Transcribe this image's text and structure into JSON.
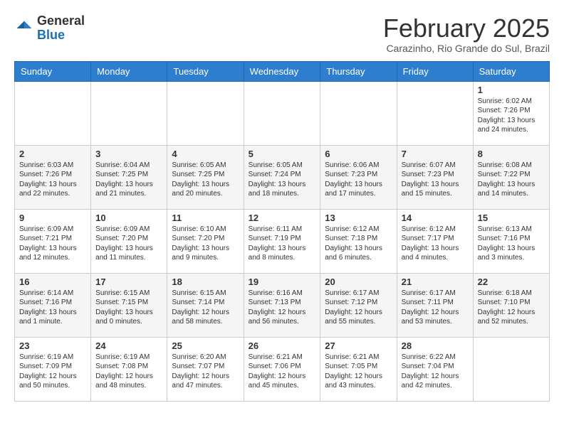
{
  "header": {
    "logo_general": "General",
    "logo_blue": "Blue",
    "month": "February 2025",
    "location": "Carazinho, Rio Grande do Sul, Brazil"
  },
  "weekdays": [
    "Sunday",
    "Monday",
    "Tuesday",
    "Wednesday",
    "Thursday",
    "Friday",
    "Saturday"
  ],
  "weeks": [
    [
      {
        "day": "",
        "info": ""
      },
      {
        "day": "",
        "info": ""
      },
      {
        "day": "",
        "info": ""
      },
      {
        "day": "",
        "info": ""
      },
      {
        "day": "",
        "info": ""
      },
      {
        "day": "",
        "info": ""
      },
      {
        "day": "1",
        "info": "Sunrise: 6:02 AM\nSunset: 7:26 PM\nDaylight: 13 hours\nand 24 minutes."
      }
    ],
    [
      {
        "day": "2",
        "info": "Sunrise: 6:03 AM\nSunset: 7:26 PM\nDaylight: 13 hours\nand 22 minutes."
      },
      {
        "day": "3",
        "info": "Sunrise: 6:04 AM\nSunset: 7:25 PM\nDaylight: 13 hours\nand 21 minutes."
      },
      {
        "day": "4",
        "info": "Sunrise: 6:05 AM\nSunset: 7:25 PM\nDaylight: 13 hours\nand 20 minutes."
      },
      {
        "day": "5",
        "info": "Sunrise: 6:05 AM\nSunset: 7:24 PM\nDaylight: 13 hours\nand 18 minutes."
      },
      {
        "day": "6",
        "info": "Sunrise: 6:06 AM\nSunset: 7:23 PM\nDaylight: 13 hours\nand 17 minutes."
      },
      {
        "day": "7",
        "info": "Sunrise: 6:07 AM\nSunset: 7:23 PM\nDaylight: 13 hours\nand 15 minutes."
      },
      {
        "day": "8",
        "info": "Sunrise: 6:08 AM\nSunset: 7:22 PM\nDaylight: 13 hours\nand 14 minutes."
      }
    ],
    [
      {
        "day": "9",
        "info": "Sunrise: 6:09 AM\nSunset: 7:21 PM\nDaylight: 13 hours\nand 12 minutes."
      },
      {
        "day": "10",
        "info": "Sunrise: 6:09 AM\nSunset: 7:20 PM\nDaylight: 13 hours\nand 11 minutes."
      },
      {
        "day": "11",
        "info": "Sunrise: 6:10 AM\nSunset: 7:20 PM\nDaylight: 13 hours\nand 9 minutes."
      },
      {
        "day": "12",
        "info": "Sunrise: 6:11 AM\nSunset: 7:19 PM\nDaylight: 13 hours\nand 8 minutes."
      },
      {
        "day": "13",
        "info": "Sunrise: 6:12 AM\nSunset: 7:18 PM\nDaylight: 13 hours\nand 6 minutes."
      },
      {
        "day": "14",
        "info": "Sunrise: 6:12 AM\nSunset: 7:17 PM\nDaylight: 13 hours\nand 4 minutes."
      },
      {
        "day": "15",
        "info": "Sunrise: 6:13 AM\nSunset: 7:16 PM\nDaylight: 13 hours\nand 3 minutes."
      }
    ],
    [
      {
        "day": "16",
        "info": "Sunrise: 6:14 AM\nSunset: 7:16 PM\nDaylight: 13 hours\nand 1 minute."
      },
      {
        "day": "17",
        "info": "Sunrise: 6:15 AM\nSunset: 7:15 PM\nDaylight: 13 hours\nand 0 minutes."
      },
      {
        "day": "18",
        "info": "Sunrise: 6:15 AM\nSunset: 7:14 PM\nDaylight: 12 hours\nand 58 minutes."
      },
      {
        "day": "19",
        "info": "Sunrise: 6:16 AM\nSunset: 7:13 PM\nDaylight: 12 hours\nand 56 minutes."
      },
      {
        "day": "20",
        "info": "Sunrise: 6:17 AM\nSunset: 7:12 PM\nDaylight: 12 hours\nand 55 minutes."
      },
      {
        "day": "21",
        "info": "Sunrise: 6:17 AM\nSunset: 7:11 PM\nDaylight: 12 hours\nand 53 minutes."
      },
      {
        "day": "22",
        "info": "Sunrise: 6:18 AM\nSunset: 7:10 PM\nDaylight: 12 hours\nand 52 minutes."
      }
    ],
    [
      {
        "day": "23",
        "info": "Sunrise: 6:19 AM\nSunset: 7:09 PM\nDaylight: 12 hours\nand 50 minutes."
      },
      {
        "day": "24",
        "info": "Sunrise: 6:19 AM\nSunset: 7:08 PM\nDaylight: 12 hours\nand 48 minutes."
      },
      {
        "day": "25",
        "info": "Sunrise: 6:20 AM\nSunset: 7:07 PM\nDaylight: 12 hours\nand 47 minutes."
      },
      {
        "day": "26",
        "info": "Sunrise: 6:21 AM\nSunset: 7:06 PM\nDaylight: 12 hours\nand 45 minutes."
      },
      {
        "day": "27",
        "info": "Sunrise: 6:21 AM\nSunset: 7:05 PM\nDaylight: 12 hours\nand 43 minutes."
      },
      {
        "day": "28",
        "info": "Sunrise: 6:22 AM\nSunset: 7:04 PM\nDaylight: 12 hours\nand 42 minutes."
      },
      {
        "day": "",
        "info": ""
      }
    ]
  ]
}
